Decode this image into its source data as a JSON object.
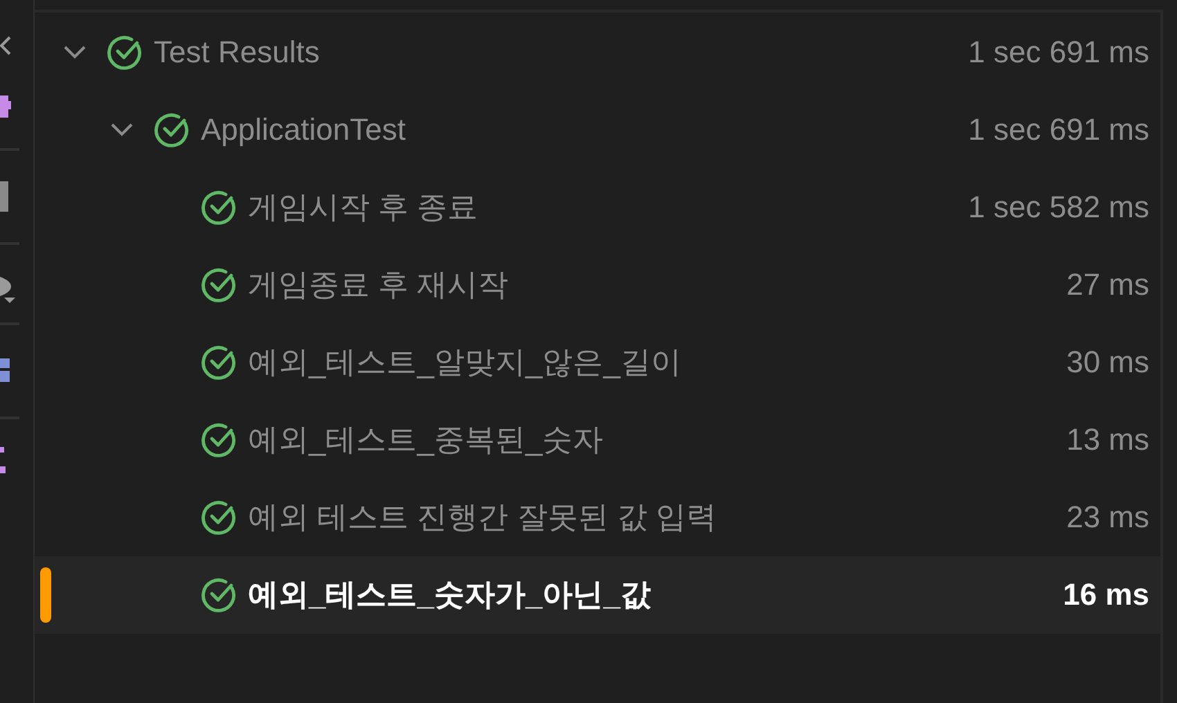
{
  "tree": [
    {
      "label": "Test Results",
      "duration": "1 sec 691 ms",
      "passed": true,
      "expanded": true,
      "selected": false,
      "children": [
        {
          "label": "ApplicationTest",
          "duration": "1 sec 691 ms",
          "passed": true,
          "expanded": true,
          "selected": false,
          "children": [
            {
              "label": "게임시작 후 종료",
              "duration": "1 sec 582 ms",
              "passed": true,
              "selected": false
            },
            {
              "label": "게임종료 후 재시작",
              "duration": "27 ms",
              "passed": true,
              "selected": false
            },
            {
              "label": "예외_테스트_알맞지_않은_길이",
              "duration": "30 ms",
              "passed": true,
              "selected": false
            },
            {
              "label": "예외_테스트_중복된_숫자",
              "duration": "13 ms",
              "passed": true,
              "selected": false
            },
            {
              "label": "예외 테스트 진행간 잘못된 값 입력",
              "duration": "23 ms",
              "passed": true,
              "selected": false
            },
            {
              "label": "예외_테스트_숫자가_아닌_값",
              "duration": "16 ms",
              "passed": true,
              "selected": true
            }
          ]
        }
      ]
    }
  ]
}
